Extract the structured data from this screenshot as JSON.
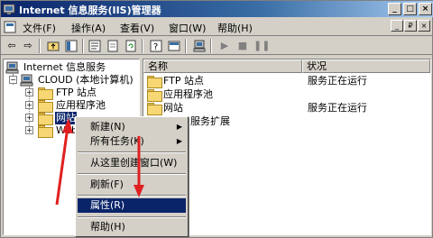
{
  "window": {
    "title": "Internet 信息服务(IIS)管理器",
    "caption_buttons": [
      "_",
      "□",
      "×"
    ]
  },
  "menubar": {
    "items": [
      "文件(F)",
      "操作(A)",
      "查看(V)",
      "窗口(W)",
      "帮助(H)"
    ],
    "mdi_buttons": [
      "_",
      "₽",
      "×"
    ]
  },
  "toolbar": {
    "icons": [
      "back-arrow-icon",
      "forward-arrow-icon",
      "up-folder-icon",
      "show-tree-icon",
      "properties-icon",
      "refresh-icon",
      "export-icon",
      "help-icon",
      "console-icon",
      "computer-icon",
      "play-icon",
      "stop-icon",
      "pause-icon"
    ]
  },
  "tree": {
    "root": "Internet 信息服务",
    "computer": "CLOUD (本地计算机)",
    "nodes": [
      "FTP 站点",
      "应用程序池",
      "网站",
      "Web 服务扩展"
    ],
    "node_truncated": "Web..."
  },
  "list": {
    "columns": [
      "名称",
      "状况"
    ],
    "rows": [
      {
        "name": "FTP 站点",
        "status": "服务正在运行"
      },
      {
        "name": "应用程序池",
        "status": ""
      },
      {
        "name": "网站",
        "status": "服务正在运行"
      },
      {
        "name": "Web 服务扩展",
        "status": ""
      }
    ],
    "row3_visible_suffix": "服务扩展"
  },
  "context_menu": {
    "items": [
      {
        "label": "新建(N)",
        "submenu": true
      },
      {
        "label": "所有任务(K)",
        "submenu": true
      },
      {
        "label": "从这里创建窗口(W)",
        "submenu": false
      },
      {
        "label": "刷新(F)",
        "submenu": false
      },
      {
        "label": "属性(R)",
        "submenu": false,
        "highlighted": true
      },
      {
        "label": "帮助(H)",
        "submenu": false
      }
    ]
  },
  "colors": {
    "titlebar": "#0a246a",
    "face": "#d4d0c8",
    "highlight": "#0a246a",
    "annotation": "#e02020"
  }
}
